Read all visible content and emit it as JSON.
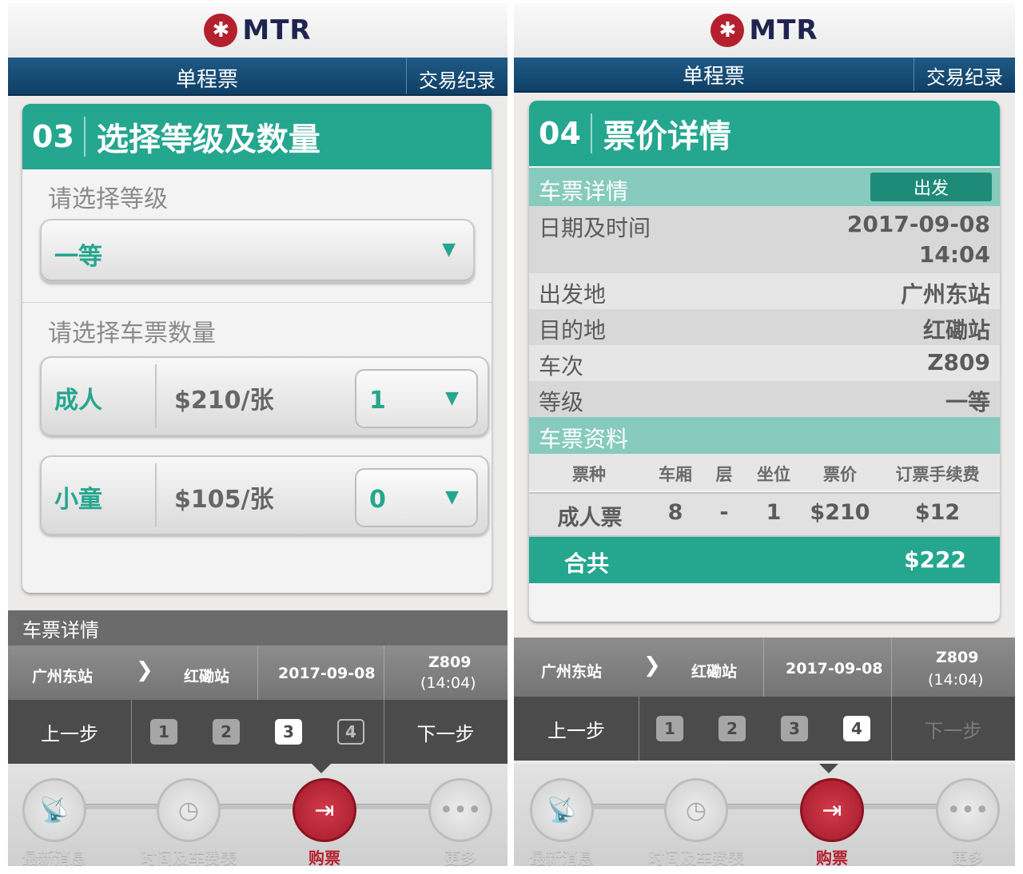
{
  "brand": {
    "logo_text": "MTR"
  },
  "nav": {
    "title": "单程票",
    "history": "交易纪录"
  },
  "left": {
    "step": {
      "num": "03",
      "title": "选择等级及数量"
    },
    "class_label": "请选择等级",
    "class_value": "一等",
    "qty_label": "请选择车票数量",
    "rows": [
      {
        "type": "成人",
        "price": "$210/张",
        "qty": "1"
      },
      {
        "type": "小童",
        "price": "$105/张",
        "qty": "0"
      }
    ]
  },
  "summary": {
    "title": "车票详情",
    "from": "广州东站",
    "to": "红磡站",
    "date": "2017-09-08",
    "train": "Z809",
    "time": "(14:04)",
    "prev": "上一步",
    "next": "下一步",
    "steps": [
      "1",
      "2",
      "3",
      "4"
    ]
  },
  "right": {
    "step": {
      "num": "04",
      "title": "票价详情"
    },
    "details_header": "车票详情",
    "depart_badge": "出发",
    "rows": [
      {
        "label": "日期及时间",
        "value": "2017-09-08",
        "value2": "14:04"
      },
      {
        "label": "出发地",
        "value": "广州东站"
      },
      {
        "label": "目的地",
        "value": "红磡站"
      },
      {
        "label": "车次",
        "value": "Z809"
      },
      {
        "label": "等级",
        "value": "一等"
      }
    ],
    "info_header": "车票资料",
    "columns": [
      "票种",
      "车厢",
      "层",
      "坐位",
      "票价",
      "订票手续费"
    ],
    "ticket": [
      "成人票",
      "8",
      "-",
      "1",
      "$210",
      "$12"
    ],
    "total_label": "合共",
    "total_value": "$222"
  },
  "tabs": [
    {
      "label": "最新消息",
      "icon": "antenna-icon"
    },
    {
      "label": "时间及车费表",
      "icon": "clock-fare-icon"
    },
    {
      "label": "购票",
      "icon": "ticket-icon"
    },
    {
      "label": "更多",
      "icon": "more-icon"
    }
  ],
  "colors": {
    "accent": "#25a68f",
    "brand": "#b4202e",
    "nav": "#1f5a85"
  }
}
